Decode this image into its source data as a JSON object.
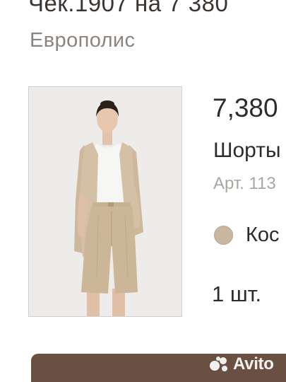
{
  "receipt": {
    "title": "Чек.1907 на 7 380",
    "store": "Европолис"
  },
  "product": {
    "image_icon": "product-photo-woman-in-beige-suit",
    "price": "7,380",
    "name": "Шорты",
    "sku": "Арт. 113",
    "color_swatch": "#c9b69f",
    "color_name": "Кос",
    "quantity": "1 шт."
  },
  "footer": {
    "bar_color": "#6a4f43"
  },
  "watermark": {
    "brand": "Avito",
    "icon": "avito-logo-icon"
  }
}
